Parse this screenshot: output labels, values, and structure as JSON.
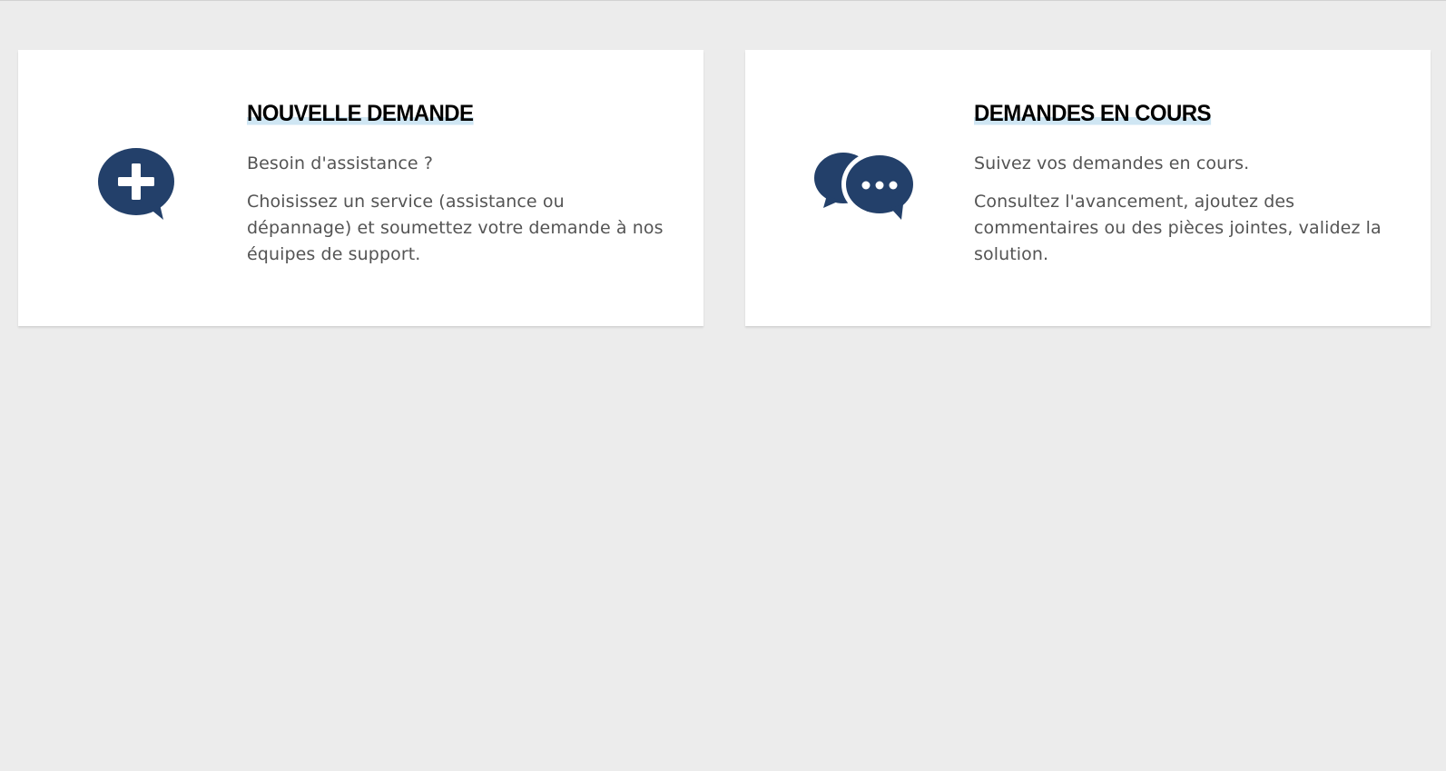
{
  "colors": {
    "page_background": "#ececec",
    "card_background": "#ffffff",
    "icon": "#23406a",
    "title": "#000000",
    "title_highlight": "#cfe6f3",
    "body_text": "#545454"
  },
  "cards": [
    {
      "icon": "speech-bubble-plus-icon",
      "title": "NOUVELLE DEMANDE",
      "lead": "Besoin d'assistance ?",
      "description": "Choisissez un service (assistance ou dépannage) et soumettez votre demande à nos équipes de support."
    },
    {
      "icon": "speech-bubbles-ellipsis-icon",
      "title": "DEMANDES EN COURS",
      "lead": "Suivez vos demandes en cours.",
      "description": "Consultez l'avancement, ajoutez des commentaires ou des pièces jointes, validez la solution."
    }
  ]
}
